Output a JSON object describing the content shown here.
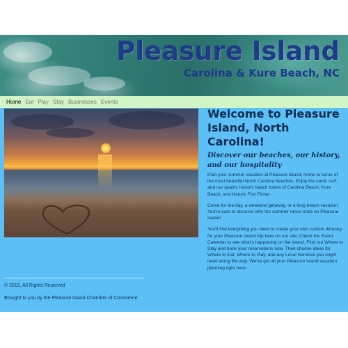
{
  "header": {
    "title": "Pleasure Island",
    "subtitle": "Carolina & Kure Beach, NC"
  },
  "nav": {
    "items": [
      {
        "label": "Home",
        "active": true
      },
      {
        "label": "Eat"
      },
      {
        "label": "Play"
      },
      {
        "label": "Stay"
      },
      {
        "label": "Businesses"
      },
      {
        "label": "Events"
      }
    ]
  },
  "main": {
    "heading": "Welcome to Pleasure Island, North Carolina!",
    "tagline": "Discover our beaches, our history, and our hospitality",
    "paragraphs": [
      "Plan your summer vacation at Pleasure Island, home to some of the most beautiful North Carolina beaches. Enjoy the sand, surf, and our quaint, historic beach towns of Carolina Beach, Kure Beach, and historic Fort Fisher.",
      "Come for the day, a weekend getaway, or a long beach vacation. You're sure to discover why the summer never ends on Pleasure Island!",
      "You'll find everything you need to create your own custom itinerary for your Pleasure Island trip here on our site. Check the Event Calendar to see what's happening on the island. Find out Where to Stay and book your reservations now. Then choose ideas for Where to Eat, Where to Play, and any Local Services you might need along the way. We've got all your Pleasure Island vacation planning right here!"
    ]
  },
  "footer": {
    "copyright": "© 2012, All Rights Reserved",
    "credit": "Brought to you by the Pleasure Island Chamber of Commerce"
  },
  "colors": {
    "page_background": "#5cc0f7",
    "nav_background": "#d2f5c8",
    "title_color": "#1f3a8a",
    "text_color": "#0f2e55"
  },
  "icons": {
    "hero_image": "beach-sunset-heart-in-sand"
  }
}
